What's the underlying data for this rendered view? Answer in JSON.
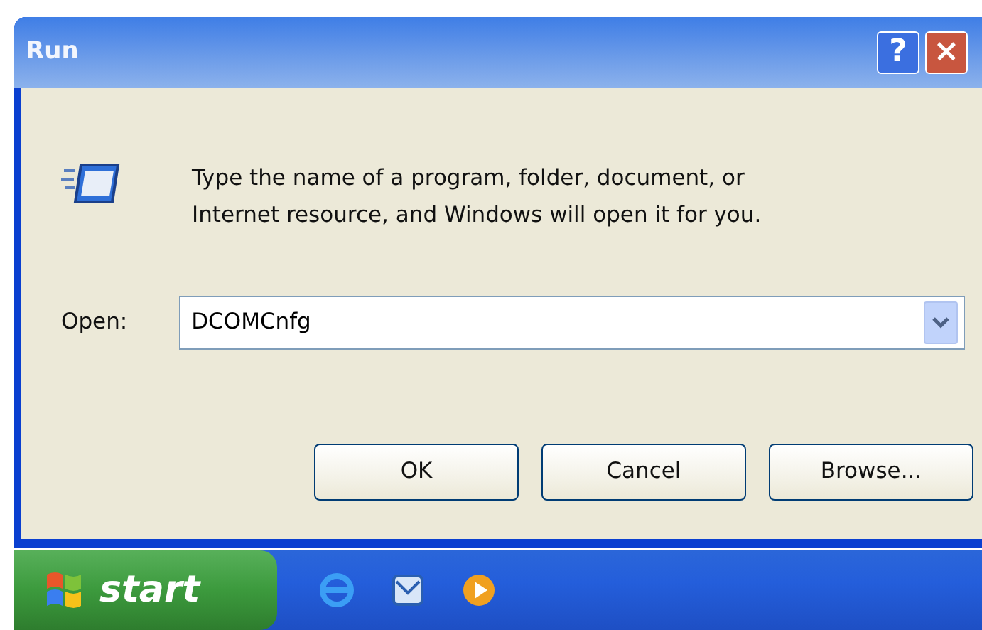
{
  "window": {
    "title": "Run",
    "title_buttons": [
      {
        "kind": "help",
        "label": "?"
      },
      {
        "kind": "close",
        "label": "×"
      }
    ]
  },
  "message": [
    "Type the name of a program, folder, document, or",
    "Internet resource, and Windows will open it for you."
  ],
  "open_field": {
    "label": "Open:",
    "value": "DCOMCnfg"
  },
  "buttons": [
    {
      "label": "OK"
    },
    {
      "label": "Cancel"
    },
    {
      "label": "Browse..."
    }
  ],
  "taskbar": {
    "start": {
      "label": "start"
    },
    "quick_launch": [
      {
        "kind": "browser"
      },
      {
        "kind": "mail"
      },
      {
        "kind": "media"
      }
    ]
  }
}
